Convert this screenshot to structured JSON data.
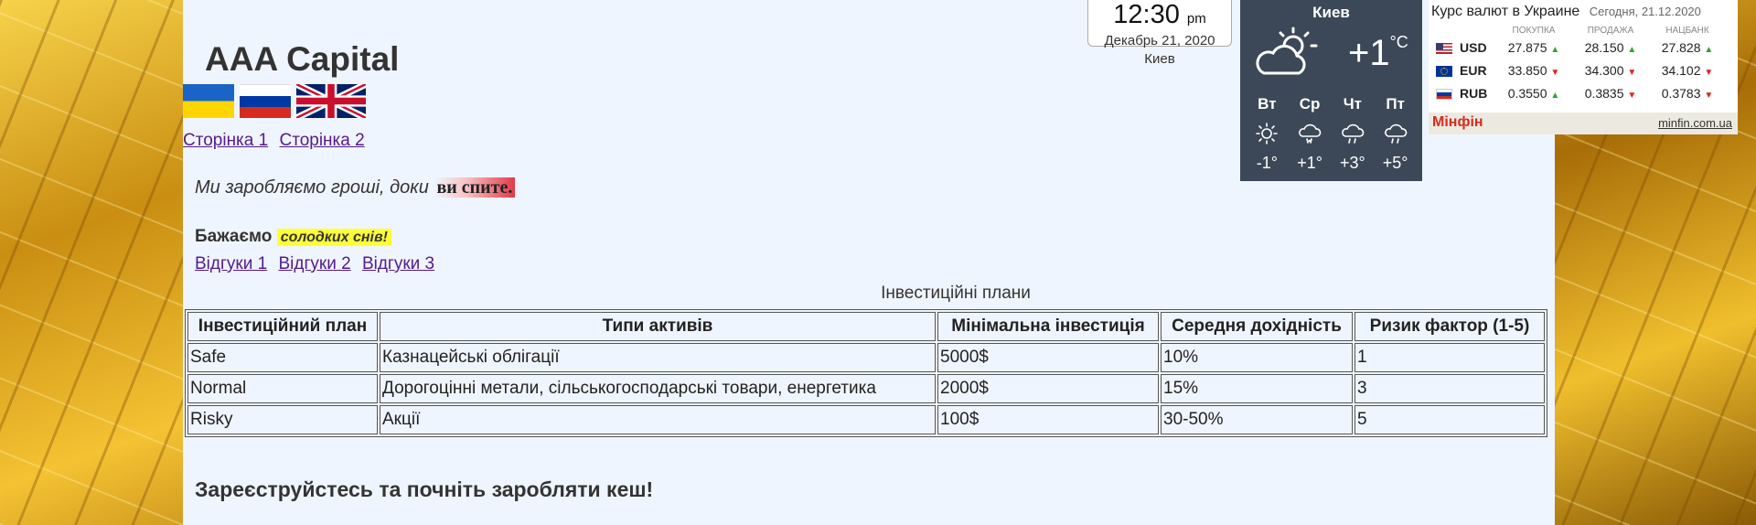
{
  "site": {
    "title": "AAA Capital",
    "flags": [
      "ua-flag",
      "ru-flag",
      "uk-flag"
    ],
    "nav": [
      "Сторінка 1",
      "Сторінка 2"
    ],
    "slogan_italic": "Ми заробляємо гроші, доки",
    "slogan_highlight": "ви спите.",
    "wish_bold": "Бажаємо",
    "wish_highlight": "солодких снів!",
    "reviews": [
      "Відгуки 1",
      "Відгуки 2",
      "Відгуки 3"
    ],
    "register_heading": "Зареєструйстесь та почніть заробляти кеш!"
  },
  "plans_table": {
    "caption": "Інвестиційні плани",
    "headers": [
      "Інвестиційний план",
      "Типи активів",
      "Мінімальна інвестиція",
      "Середня дохідність",
      "Ризик фактор (1-5)"
    ],
    "rows": [
      [
        "Safe",
        "Казнацейські облігації",
        "5000$",
        "10%",
        "1"
      ],
      [
        "Normal",
        "Дорогоцінні метали, сільськогосподарські товари, енергетика",
        "2000$",
        "15%",
        "3"
      ],
      [
        "Risky",
        "Акції",
        "100$",
        "30-50%",
        "5"
      ]
    ]
  },
  "clock": {
    "time": "12:30",
    "ampm": "pm",
    "date": "Декабрь 21, 2020",
    "city": "Киев"
  },
  "weather": {
    "city": "Киев",
    "current_icon": "partly-cloudy-icon",
    "current_temp": "+1",
    "unit": "°C",
    "forecast": [
      {
        "day": "Вт",
        "icon": "sun-icon",
        "temp": "-1°"
      },
      {
        "day": "Ср",
        "icon": "snow-cloud-icon",
        "temp": "+1°"
      },
      {
        "day": "Чт",
        "icon": "rain-cloud-icon",
        "temp": "+3°"
      },
      {
        "day": "Пт",
        "icon": "rain-cloud-icon",
        "temp": "+5°"
      }
    ]
  },
  "currency": {
    "title": "Курс валют в Украине",
    "date": "Сегодня, 21.12.2020",
    "columns": [
      "ПОКУПКА",
      "ПРОДАЖА",
      "НАЦБАНК"
    ],
    "rows": [
      {
        "code": "USD",
        "buy": "27.875",
        "buy_dir": "up",
        "sell": "28.150",
        "sell_dir": "up",
        "nbu": "27.828",
        "nbu_dir": "up"
      },
      {
        "code": "EUR",
        "buy": "33.850",
        "buy_dir": "down",
        "sell": "34.300",
        "sell_dir": "down",
        "nbu": "34.102",
        "nbu_dir": "down"
      },
      {
        "code": "RUB",
        "buy": "0.3550",
        "buy_dir": "up",
        "sell": "0.3835",
        "sell_dir": "down",
        "nbu": "0.3783",
        "nbu_dir": "down"
      }
    ],
    "brand": "Мінфін",
    "link": "minfin.com.ua"
  },
  "colors": {
    "content_bg": "#eef5ff",
    "weather_bg": "#3c4858",
    "brand_red": "#d42b1e",
    "highlight_yellow": "#ffff38",
    "link": "#551a8b"
  }
}
